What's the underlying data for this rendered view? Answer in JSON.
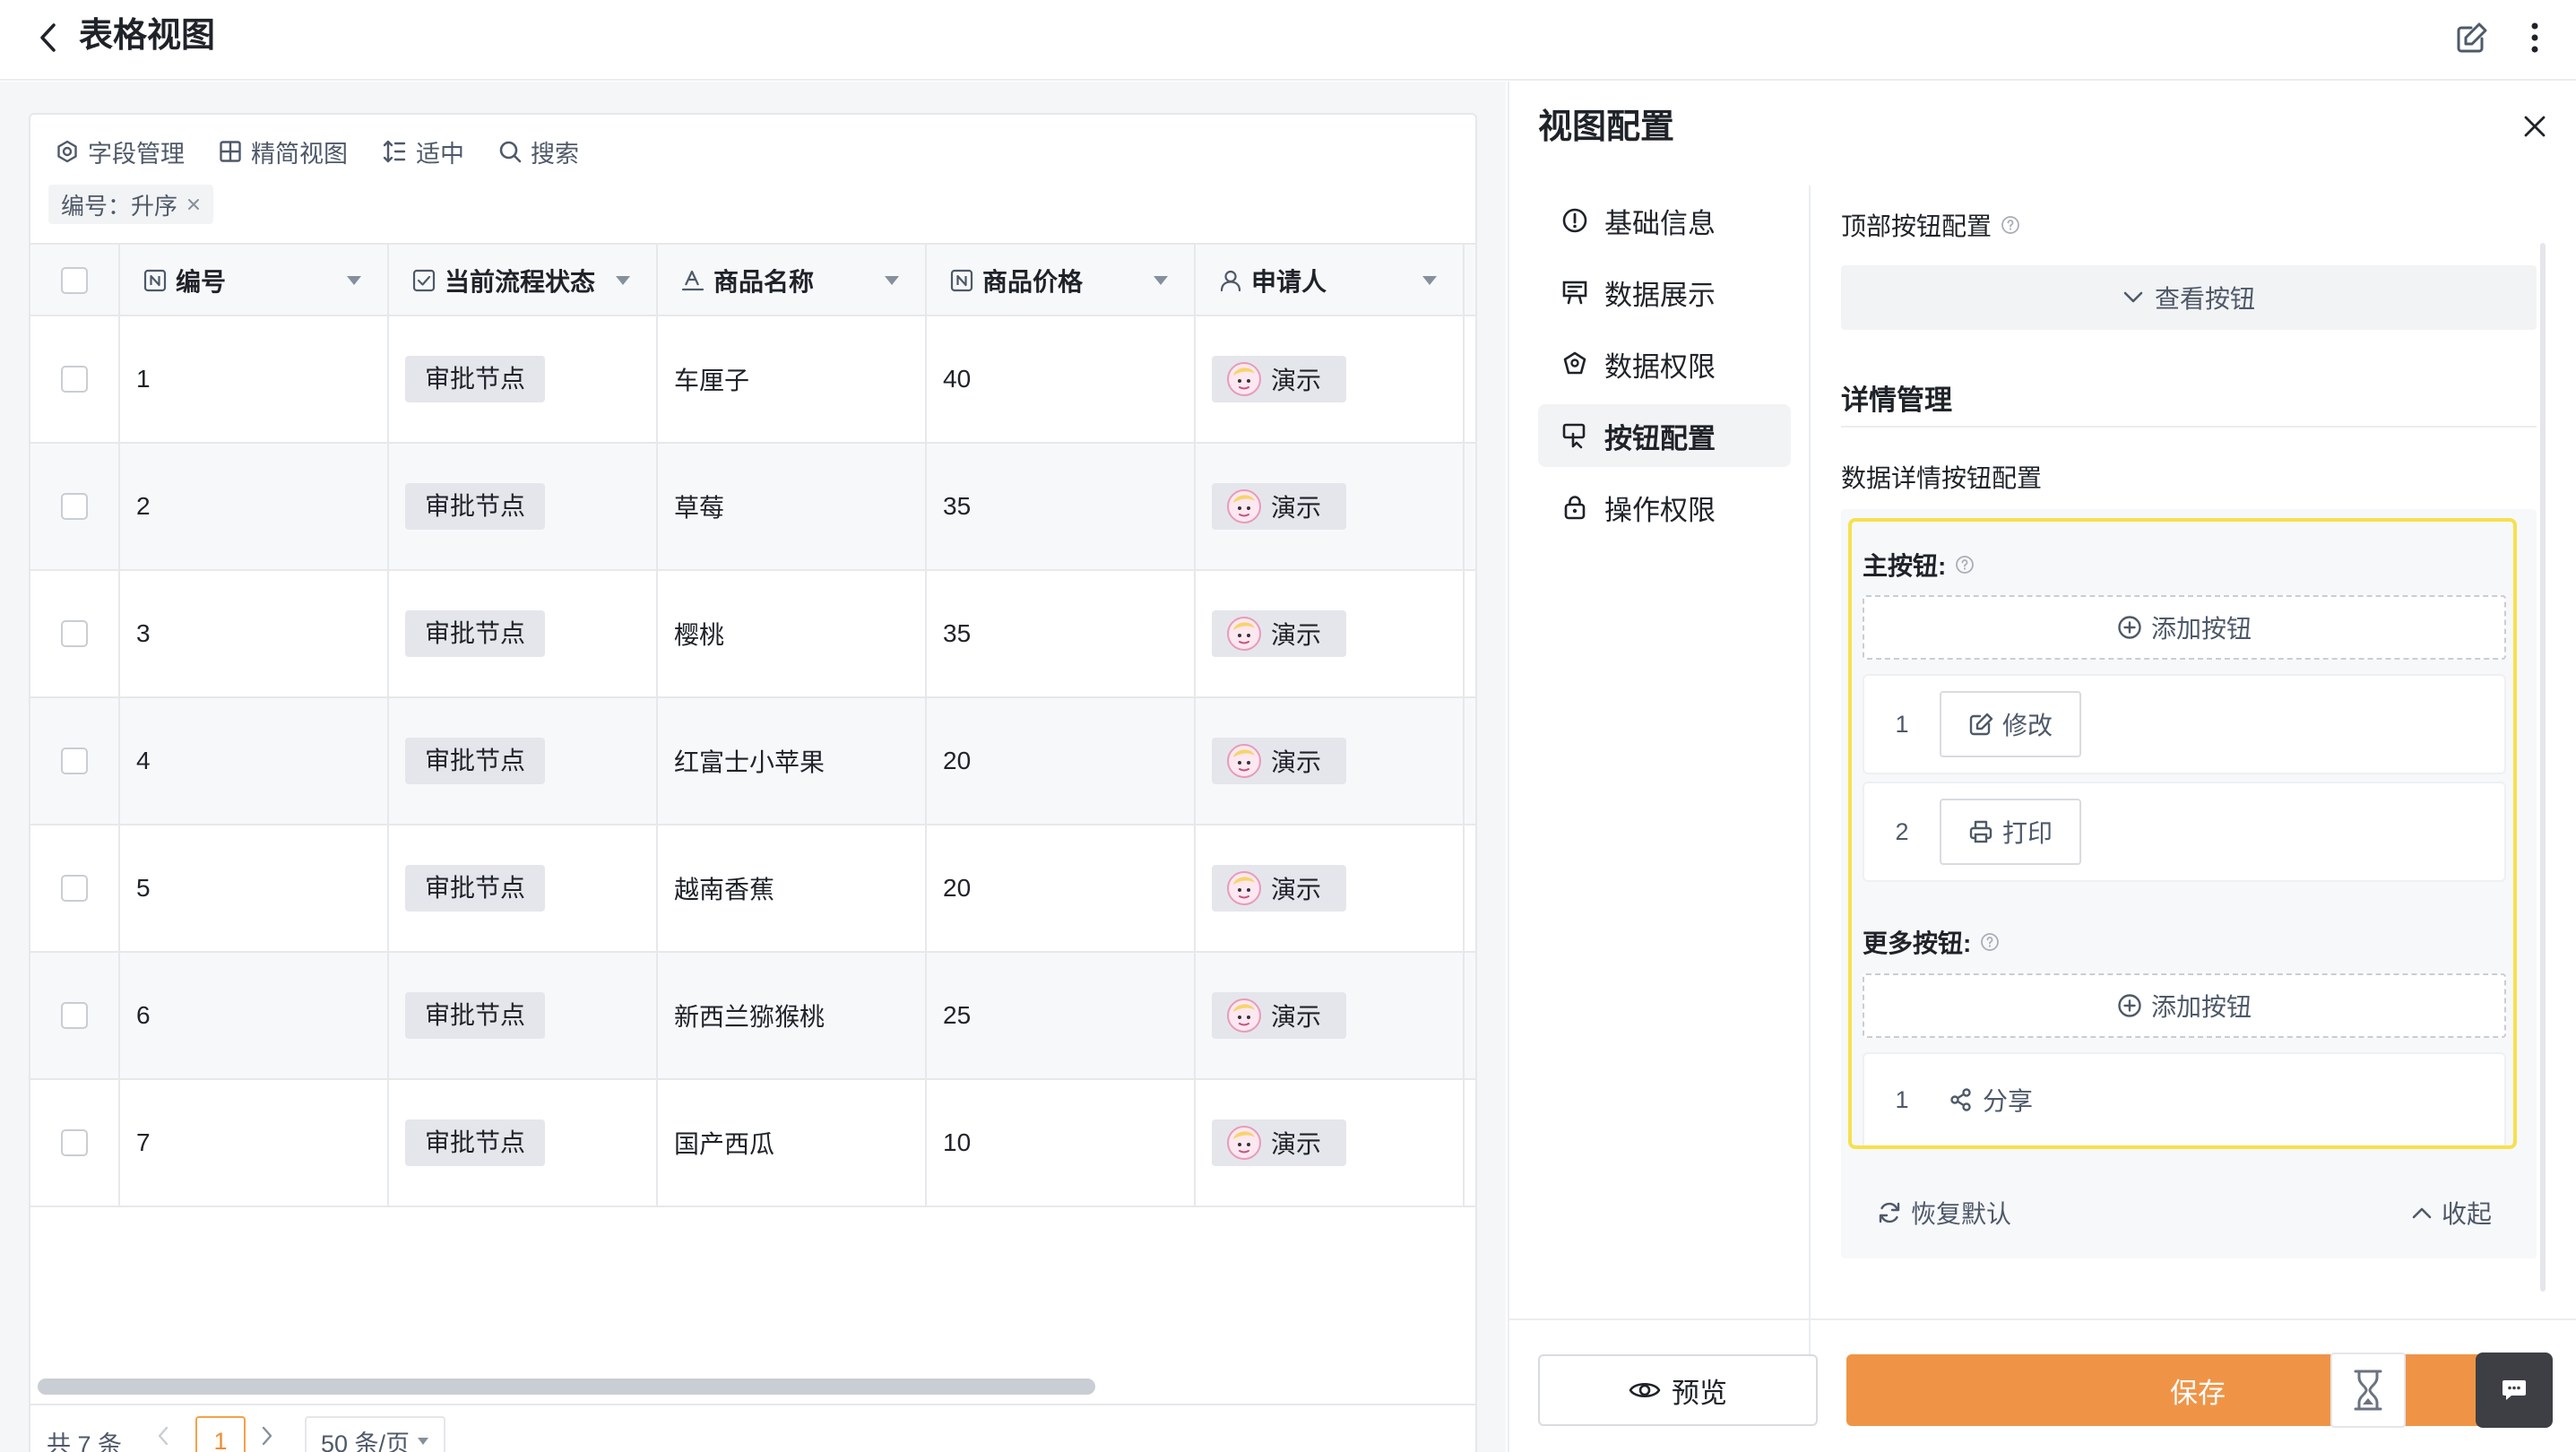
{
  "header": {
    "title": "表格视图"
  },
  "toolbar": {
    "field_manage": "字段管理",
    "compact_view": "精简视图",
    "row_height": "适中",
    "search": "搜索"
  },
  "sort_tag": {
    "label": "编号：升序"
  },
  "table": {
    "columns": [
      "编号",
      "当前流程状态",
      "商品名称",
      "商品价格",
      "申请人"
    ],
    "rows": [
      {
        "id": "1",
        "status": "审批节点",
        "name": "车厘子",
        "price": "40",
        "applicant": "演示"
      },
      {
        "id": "2",
        "status": "审批节点",
        "name": "草莓",
        "price": "35",
        "applicant": "演示"
      },
      {
        "id": "3",
        "status": "审批节点",
        "name": "樱桃",
        "price": "35",
        "applicant": "演示"
      },
      {
        "id": "4",
        "status": "审批节点",
        "name": "红富士小苹果",
        "price": "20",
        "applicant": "演示"
      },
      {
        "id": "5",
        "status": "审批节点",
        "name": "越南香蕉",
        "price": "20",
        "applicant": "演示"
      },
      {
        "id": "6",
        "status": "审批节点",
        "name": "新西兰猕猴桃",
        "price": "25",
        "applicant": "演示"
      },
      {
        "id": "7",
        "status": "审批节点",
        "name": "国产西瓜",
        "price": "10",
        "applicant": "演示"
      }
    ]
  },
  "pagination": {
    "total": "共 7 条",
    "current_page": "1",
    "page_size": "50 条/页"
  },
  "config_panel": {
    "title": "视图配置",
    "menu": [
      {
        "label": "基础信息",
        "icon": "info-circle-icon",
        "active": false
      },
      {
        "label": "数据展示",
        "icon": "presentation-icon",
        "active": false
      },
      {
        "label": "数据权限",
        "icon": "data-permission-icon",
        "active": false
      },
      {
        "label": "按钮配置",
        "icon": "button-config-icon",
        "active": true
      },
      {
        "label": "操作权限",
        "icon": "lock-icon",
        "active": false
      }
    ],
    "top_buttons_label": "顶部按钮配置",
    "view_buttons": "查看按钮",
    "detail_section": "详情管理",
    "detail_buttons_label": "数据详情按钮配置",
    "primary_label": "主按钮:",
    "add_button": "添加按钮",
    "primary_buttons": [
      {
        "index": "1",
        "label": "修改",
        "icon": "edit-icon"
      },
      {
        "index": "2",
        "label": "打印",
        "icon": "printer-icon"
      }
    ],
    "more_label": "更多按钮:",
    "more_buttons": [
      {
        "index": "1",
        "label": "分享",
        "icon": "share-icon"
      }
    ],
    "restore": "恢复默认",
    "collapse": "收起",
    "preview": "预览",
    "save": "保存"
  },
  "colors": {
    "accent": "#ef9447",
    "highlight_border": "#f7e04e",
    "page_border": "#f5a04a"
  }
}
